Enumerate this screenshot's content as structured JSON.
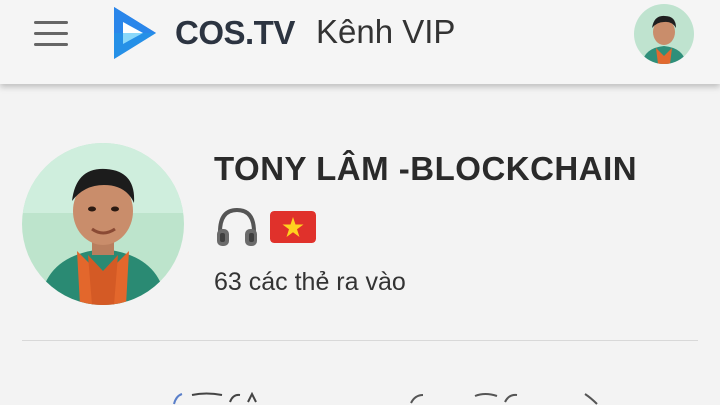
{
  "header": {
    "brand": "COS.TV",
    "title": "Kênh VIP",
    "menu_icon": "hamburger-menu-icon",
    "logo_icon": "cos-tv-play-logo",
    "colors": {
      "logo_dark": "#1f5fd6",
      "logo_light": "#29b8f5",
      "brand_text": "#2c3441"
    }
  },
  "profile": {
    "name": "TONY LÂM -BLOCKCHAIN",
    "badges": [
      "headphones-icon",
      "vietnam-flag-icon"
    ],
    "followers": "63 các thẻ ra vào"
  }
}
